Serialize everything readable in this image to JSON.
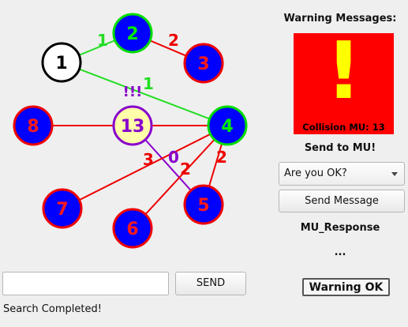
{
  "graph": {
    "nodes": [
      {
        "id": "1",
        "label": "1",
        "fill": "#ffffff",
        "stroke": "#000000",
        "text": "#000000"
      },
      {
        "id": "2",
        "label": "2",
        "fill": "#0000ff",
        "stroke": "#00dd00",
        "text": "#00ee00"
      },
      {
        "id": "3",
        "label": "3",
        "fill": "#0000ff",
        "stroke": "#ee0000",
        "text": "#ff1a1a"
      },
      {
        "id": "4",
        "label": "4",
        "fill": "#0000ff",
        "stroke": "#00dd00",
        "text": "#00ee00"
      },
      {
        "id": "5",
        "label": "5",
        "fill": "#0000ff",
        "stroke": "#ee0000",
        "text": "#ff1a1a"
      },
      {
        "id": "6",
        "label": "6",
        "fill": "#0000ff",
        "stroke": "#ee0000",
        "text": "#ff1a1a"
      },
      {
        "id": "7",
        "label": "7",
        "fill": "#0000ff",
        "stroke": "#ee0000",
        "text": "#ff1a1a"
      },
      {
        "id": "8",
        "label": "8",
        "fill": "#0000ff",
        "stroke": "#ee0000",
        "text": "#ff1a1a"
      },
      {
        "id": "13",
        "label": "13",
        "fill": "#ffffaa",
        "stroke": "#8800cc",
        "text": "#8800cc"
      }
    ],
    "edges": [
      {
        "from": "1",
        "to": "2",
        "color": "#22dd22",
        "label": "1",
        "label_color": "#22dd22"
      },
      {
        "from": "2",
        "to": "3",
        "color": "#ee0000",
        "label": "2",
        "label_color": "#ee0000"
      },
      {
        "from": "1",
        "to": "4",
        "color": "#22dd22",
        "label": "1",
        "label_color": "#22dd22"
      },
      {
        "from": "8",
        "to": "4",
        "color": "#ee0000",
        "label": "",
        "label_color": "#ee0000"
      },
      {
        "from": "13",
        "to": "5",
        "color": "#8800cc",
        "label": "0",
        "label_color": "#8800cc"
      },
      {
        "from": "7",
        "to": "4",
        "color": "#ee0000",
        "label": "3",
        "label_color": "#ee0000"
      },
      {
        "from": "6",
        "to": "4",
        "color": "#ee0000",
        "label": "2",
        "label_color": "#ee0000"
      },
      {
        "from": "5",
        "to": "4",
        "color": "#ee0000",
        "label": "2",
        "label_color": "#ee0000"
      }
    ],
    "alert_marker": {
      "text": "!!!",
      "color": "#8800cc"
    }
  },
  "warning": {
    "title": "Warning Messages:",
    "icon": "exclamation-icon",
    "symbol": "!",
    "box_color": "#ff0000",
    "symbol_color": "#ffff00",
    "collision_text": "Collision MU: 13"
  },
  "send_panel": {
    "label": "Send to MU!",
    "selected_message": "Are you OK?",
    "send_button": "Send Message"
  },
  "response": {
    "label": "MU_Response",
    "value": "...",
    "ok_button": "Warning OK"
  },
  "search": {
    "value": "",
    "send_button": "SEND",
    "status": "Search Completed!"
  }
}
